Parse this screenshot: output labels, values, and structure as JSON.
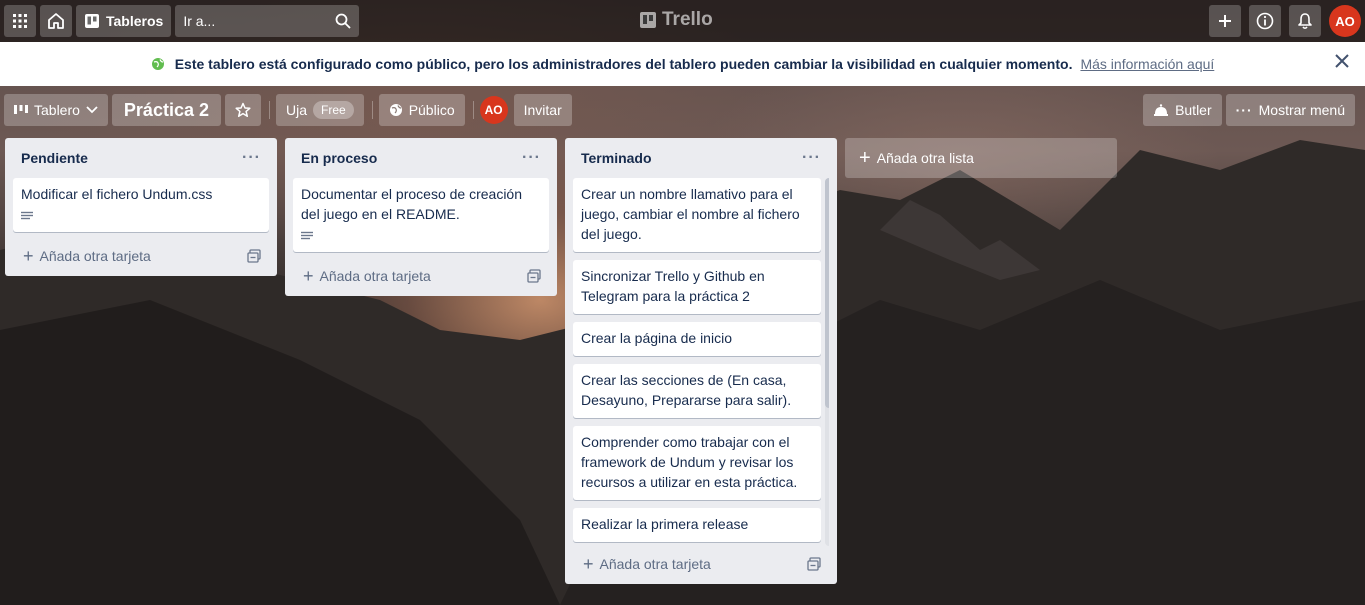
{
  "nav": {
    "boards_label": "Tableros",
    "search_placeholder": "Ir a...",
    "logo": "Trello",
    "avatar_initials": "AO"
  },
  "banner": {
    "message": "Este tablero está configurado como público, pero los administradores del tablero pueden cambiar la visibilidad en cualquier momento.",
    "link": "Más información aquí"
  },
  "board": {
    "view_label": "Tablero",
    "title": "Práctica 2",
    "workspace": "Uja",
    "workspace_badge": "Free",
    "visibility": "Público",
    "member_initials": "AO",
    "invite_label": "Invitar",
    "butler_label": "Butler",
    "menu_label": "Mostrar menú"
  },
  "lists": [
    {
      "title": "Pendiente",
      "cards": [
        {
          "text": "Modificar el fichero Undum.css",
          "has_description": true
        }
      ],
      "add_label": "Añada otra tarjeta"
    },
    {
      "title": "En proceso",
      "cards": [
        {
          "text": "Documentar el proceso de creación del juego en el README.",
          "has_description": true
        }
      ],
      "add_label": "Añada otra tarjeta"
    },
    {
      "title": "Terminado",
      "cards": [
        {
          "text": "Crear un nombre llamativo para el juego, cambiar el nombre al fichero del juego."
        },
        {
          "text": "Sincronizar Trello y Github en Telegram para la práctica 2"
        },
        {
          "text": "Crear la página de inicio"
        },
        {
          "text": "Crear las secciones de (En casa, Desayuno, Prepararse para salir)."
        },
        {
          "text": "Comprender como trabajar con el framework de Undum y revisar los recursos a utilizar en esta práctica."
        },
        {
          "text": "Realizar la primera release"
        }
      ],
      "add_label": "Añada otra tarjeta"
    }
  ],
  "add_list_label": "Añada otra lista"
}
